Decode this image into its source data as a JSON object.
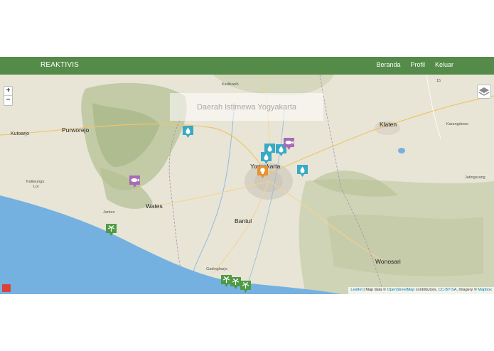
{
  "navbar": {
    "brand": "REAKTIVIS",
    "links": [
      "Beranda",
      "Profil",
      "Keluar"
    ]
  },
  "map": {
    "zoom_in": "+",
    "zoom_out": "−",
    "region_title": "Daerah Istimewa Yogyakarta",
    "layers_icon": "layers-icon",
    "places": {
      "kutoarjo": "Kutoarjo",
      "purworejo": "Purworejo",
      "kaliwungu": "Kaliwungu",
      "lor": "Lor",
      "janten": "Janten",
      "wates": "Wates",
      "yogyakarta": "Yogyakarta",
      "bantul": "Bantul",
      "gadingharjo": "Gadingharjo",
      "kadiluwih": "Kadiluwih",
      "klaten": "Klaten",
      "karangdowo": "Karangdowo",
      "jatingarang": "Jatingarang",
      "wonosari": "Wonosari",
      "road_15": "15"
    },
    "attribution": {
      "leaflet": "Leaflet",
      "sep": " | Map data © ",
      "osm": "OpenStreetMap",
      "contrib": " contributors, ",
      "license": "CC-BY-SA",
      "imagery": ", Imagery © ",
      "mapbox": "Mapbox"
    },
    "markers": [
      {
        "type": "water",
        "icon": "water-drop-icon",
        "color": "#3aa9c6"
      },
      {
        "type": "water",
        "icon": "water-drop-icon",
        "color": "#3aa9c6"
      },
      {
        "type": "water",
        "icon": "water-drop-icon",
        "color": "#3aa9c6"
      },
      {
        "type": "water",
        "icon": "water-drop-icon",
        "color": "#3aa9c6"
      },
      {
        "type": "water",
        "icon": "water-drop-icon",
        "color": "#3aa9c6"
      },
      {
        "type": "fish",
        "icon": "fish-icon",
        "color": "#a86bb5"
      },
      {
        "type": "fish",
        "icon": "fish-icon",
        "color": "#a86bb5"
      },
      {
        "type": "fire",
        "icon": "lightbulb-icon",
        "color": "#e69333"
      },
      {
        "type": "beach",
        "icon": "palm-tree-icon",
        "color": "#4f9a45"
      },
      {
        "type": "beach",
        "icon": "palm-tree-icon",
        "color": "#4f9a45"
      },
      {
        "type": "beach",
        "icon": "palm-tree-icon",
        "color": "#4f9a45"
      },
      {
        "type": "beach",
        "icon": "palm-tree-icon",
        "color": "#4f9a45"
      }
    ],
    "colors": {
      "sea": "#74b1e0",
      "land": "#e8e5d6",
      "hills": "#b9c49a",
      "urban": "#d7d2c6",
      "navbar": "#558b49"
    }
  }
}
